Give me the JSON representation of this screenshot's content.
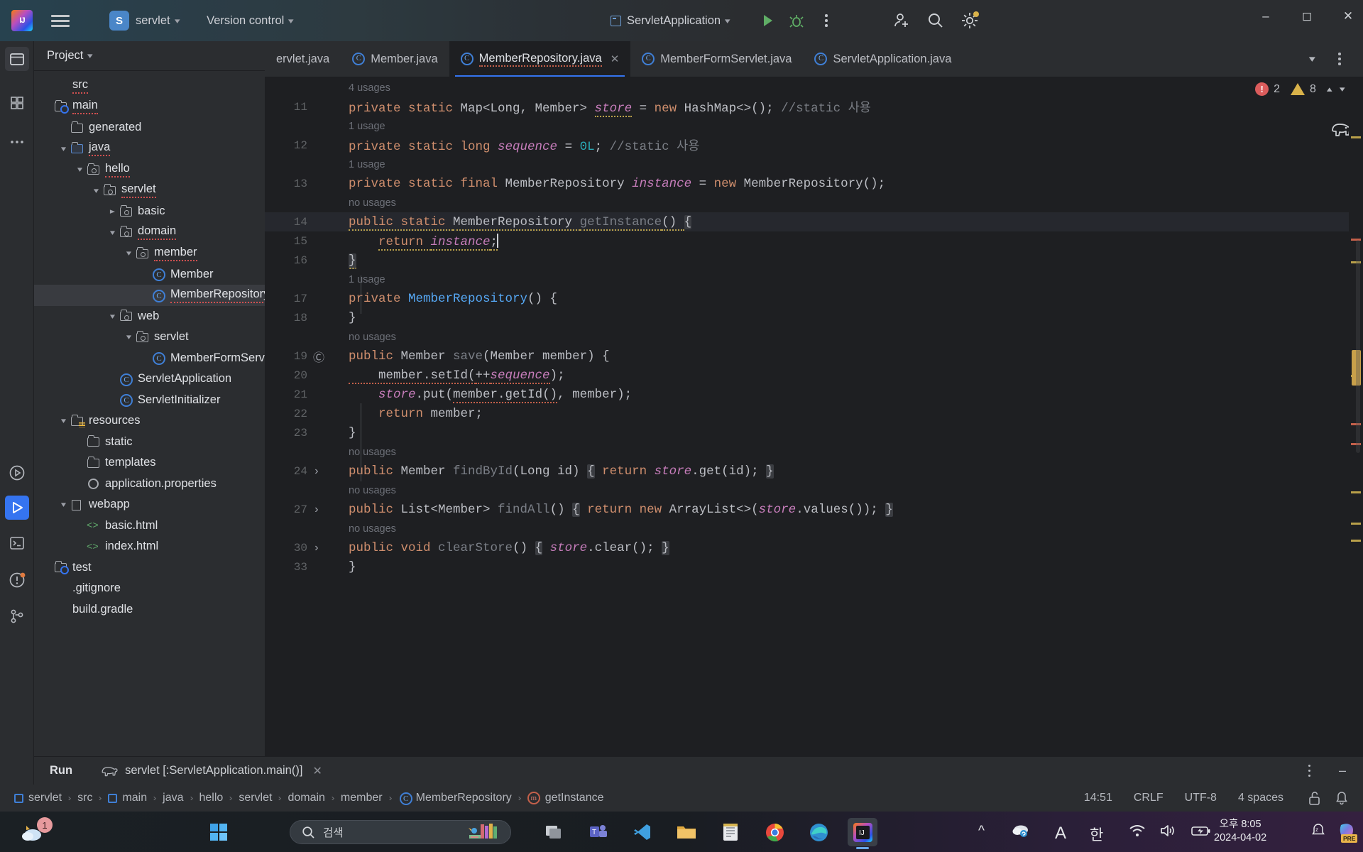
{
  "titlebar": {
    "logo": "intellij-logo",
    "project_initial": "S",
    "project_name": "servlet",
    "version_control": "Version control",
    "run_config": "ServletApplication",
    "icons": [
      "run-icon",
      "debug-icon",
      "more-actions-icon",
      "add-user-icon",
      "search-icon",
      "settings-icon"
    ],
    "window_controls": [
      "minimize",
      "maximize",
      "close"
    ]
  },
  "project_panel": {
    "title": "Project",
    "tree": [
      {
        "label": "src",
        "indent": 0,
        "arrow": "",
        "icon": "none",
        "squiggle": true
      },
      {
        "label": "main",
        "indent": 0,
        "arrow": "",
        "icon": "source-folder",
        "squiggle": true
      },
      {
        "label": "generated",
        "indent": 1,
        "arrow": "",
        "icon": "folder",
        "squiggle": false
      },
      {
        "label": "java",
        "indent": 1,
        "arrow": "down",
        "icon": "folder-blue",
        "squiggle": true
      },
      {
        "label": "hello",
        "indent": 2,
        "arrow": "down",
        "icon": "package",
        "squiggle": true
      },
      {
        "label": "servlet",
        "indent": 3,
        "arrow": "down",
        "icon": "package",
        "squiggle": true
      },
      {
        "label": "basic",
        "indent": 4,
        "arrow": "right",
        "icon": "package",
        "squiggle": false
      },
      {
        "label": "domain",
        "indent": 4,
        "arrow": "down",
        "icon": "package",
        "squiggle": true
      },
      {
        "label": "member",
        "indent": 5,
        "arrow": "down",
        "icon": "package",
        "squiggle": true
      },
      {
        "label": "Member",
        "indent": 6,
        "arrow": "",
        "icon": "class",
        "squiggle": false
      },
      {
        "label": "MemberRepository",
        "indent": 6,
        "arrow": "",
        "icon": "class",
        "squiggle": true,
        "selected": true
      },
      {
        "label": "web",
        "indent": 4,
        "arrow": "down",
        "icon": "package",
        "squiggle": false
      },
      {
        "label": "servlet",
        "indent": 5,
        "arrow": "down",
        "icon": "package",
        "squiggle": false
      },
      {
        "label": "MemberFormServlet",
        "indent": 6,
        "arrow": "",
        "icon": "class",
        "squiggle": false
      },
      {
        "label": "ServletApplication",
        "indent": 4,
        "arrow": "",
        "icon": "class",
        "squiggle": false
      },
      {
        "label": "ServletInitializer",
        "indent": 4,
        "arrow": "",
        "icon": "class",
        "squiggle": false
      },
      {
        "label": "resources",
        "indent": 1,
        "arrow": "down",
        "icon": "resource-folder",
        "squiggle": false
      },
      {
        "label": "static",
        "indent": 2,
        "arrow": "",
        "icon": "folder",
        "squiggle": false
      },
      {
        "label": "templates",
        "indent": 2,
        "arrow": "",
        "icon": "folder",
        "squiggle": false
      },
      {
        "label": "application.properties",
        "indent": 2,
        "arrow": "",
        "icon": "properties",
        "squiggle": false
      },
      {
        "label": "webapp",
        "indent": 1,
        "arrow": "down",
        "icon": "doc-folder",
        "squiggle": false
      },
      {
        "label": "basic.html",
        "indent": 2,
        "arrow": "",
        "icon": "html",
        "squiggle": false
      },
      {
        "label": "index.html",
        "indent": 2,
        "arrow": "",
        "icon": "html",
        "squiggle": false
      },
      {
        "label": "test",
        "indent": 0,
        "arrow": "",
        "icon": "source-folder",
        "squiggle": false
      },
      {
        "label": ".gitignore",
        "indent": 0,
        "arrow": "",
        "icon": "none",
        "squiggle": false
      },
      {
        "label": "build.gradle",
        "indent": 0,
        "arrow": "",
        "icon": "none",
        "squiggle": false
      }
    ]
  },
  "editor": {
    "tabs": [
      {
        "label": "ServletApplication.java",
        "icon": "class-icon",
        "active": false,
        "truncated_left": true,
        "display": "ervlet.java"
      },
      {
        "label": "Member.java",
        "icon": "class-icon",
        "active": false
      },
      {
        "label": "MemberRepository.java",
        "icon": "class-icon",
        "active": true,
        "closable": true
      },
      {
        "label": "MemberFormServlet.java",
        "icon": "class-icon",
        "active": false
      },
      {
        "label": "ServletApplication.java",
        "icon": "class-icon",
        "active": false
      }
    ],
    "tab_overflow_icons": [
      "chevron-down-icon",
      "more-tabs-icon"
    ],
    "inspections": {
      "errors": "2",
      "warnings": "8"
    },
    "lines": [
      {
        "type": "hint",
        "text": "4 usages"
      },
      {
        "type": "code",
        "num": "11",
        "tokens": [
          {
            "t": "private static ",
            "c": "kw"
          },
          {
            "t": "Map<Long, Member> ",
            "c": "pl"
          },
          {
            "t": "store",
            "c": "fld wv"
          },
          {
            "t": " = ",
            "c": "pl"
          },
          {
            "t": "new ",
            "c": "kw"
          },
          {
            "t": "HashMap<>(); ",
            "c": "pl"
          },
          {
            "t": "//static 사용",
            "c": "cmt"
          }
        ]
      },
      {
        "type": "hint",
        "text": "1 usage"
      },
      {
        "type": "code",
        "num": "12",
        "tokens": [
          {
            "t": "private static long ",
            "c": "kw"
          },
          {
            "t": "sequence",
            "c": "fld"
          },
          {
            "t": " = ",
            "c": "pl"
          },
          {
            "t": "0L",
            "c": "num"
          },
          {
            "t": "; ",
            "c": "pl"
          },
          {
            "t": "//static 사용",
            "c": "cmt"
          }
        ]
      },
      {
        "type": "hint",
        "text": "1 usage"
      },
      {
        "type": "code",
        "num": "13",
        "tokens": [
          {
            "t": "private static final ",
            "c": "kw"
          },
          {
            "t": "MemberRepository ",
            "c": "pl"
          },
          {
            "t": "instance",
            "c": "fld"
          },
          {
            "t": " = ",
            "c": "pl"
          },
          {
            "t": "new ",
            "c": "kw"
          },
          {
            "t": "MemberRepository();",
            "c": "pl"
          }
        ]
      },
      {
        "type": "hint",
        "text": "no usages"
      },
      {
        "type": "code",
        "num": "14",
        "current": true,
        "tokens": [
          {
            "t": "public static ",
            "c": "kw wv"
          },
          {
            "t": "MemberRepository ",
            "c": "pl wv"
          },
          {
            "t": "getInstance",
            "c": "mth wv"
          },
          {
            "t": "() ",
            "c": "pl wv"
          },
          {
            "t": "{",
            "c": "pl fold-chip"
          }
        ]
      },
      {
        "type": "code",
        "num": "15",
        "tokens": [
          {
            "t": "    ",
            "c": "pl"
          },
          {
            "t": "return ",
            "c": "kw wv"
          },
          {
            "t": "instance",
            "c": "fld wv"
          },
          {
            "t": ";",
            "c": "pl wv"
          }
        ]
      },
      {
        "type": "code",
        "num": "16",
        "tokens": [
          {
            "t": "}",
            "c": "pl wv fold-chip"
          }
        ]
      },
      {
        "type": "hint",
        "text": "1 usage"
      },
      {
        "type": "code",
        "num": "17",
        "tokens": [
          {
            "t": "private ",
            "c": "kw"
          },
          {
            "t": "MemberRepository",
            "c": "mthb"
          },
          {
            "t": "() {",
            "c": "pl"
          }
        ]
      },
      {
        "type": "code",
        "num": "18",
        "tokens": [
          {
            "t": "}",
            "c": "pl"
          }
        ]
      },
      {
        "type": "hint",
        "text": "no usages"
      },
      {
        "type": "code",
        "num": "19",
        "gutter": "@",
        "tokens": [
          {
            "t": "public ",
            "c": "kw"
          },
          {
            "t": "Member ",
            "c": "pl"
          },
          {
            "t": "save",
            "c": "mth"
          },
          {
            "t": "(Member member) {",
            "c": "pl"
          }
        ]
      },
      {
        "type": "code",
        "num": "20",
        "tokens": [
          {
            "t": "    member.setId(",
            "c": "pl wvr"
          },
          {
            "t": "++",
            "c": "pl wvr"
          },
          {
            "t": "sequence",
            "c": "fld wvr"
          },
          {
            "t": ");",
            "c": "pl"
          }
        ]
      },
      {
        "type": "code",
        "num": "21",
        "tokens": [
          {
            "t": "    ",
            "c": "pl"
          },
          {
            "t": "store",
            "c": "fld"
          },
          {
            "t": ".put(",
            "c": "pl"
          },
          {
            "t": "member.getId()",
            "c": "pl wvr"
          },
          {
            "t": ", member);",
            "c": "pl"
          }
        ]
      },
      {
        "type": "code",
        "num": "22",
        "tokens": [
          {
            "t": "    ",
            "c": "pl"
          },
          {
            "t": "return ",
            "c": "kw"
          },
          {
            "t": "member;",
            "c": "pl"
          }
        ]
      },
      {
        "type": "code",
        "num": "23",
        "tokens": [
          {
            "t": "}",
            "c": "pl"
          }
        ]
      },
      {
        "type": "hint",
        "text": "no usages"
      },
      {
        "type": "code",
        "num": "24",
        "gutter": ">",
        "tokens": [
          {
            "t": "public ",
            "c": "kw"
          },
          {
            "t": "Member ",
            "c": "pl"
          },
          {
            "t": "findById",
            "c": "mth"
          },
          {
            "t": "(Long id) ",
            "c": "pl"
          },
          {
            "t": "{",
            "c": "pl fold-chip"
          },
          {
            "t": " ",
            "c": "pl"
          },
          {
            "t": "return ",
            "c": "kw"
          },
          {
            "t": "store",
            "c": "fld"
          },
          {
            "t": ".get(id); ",
            "c": "pl"
          },
          {
            "t": "}",
            "c": "pl fold-chip"
          }
        ]
      },
      {
        "type": "hint",
        "text": "no usages"
      },
      {
        "type": "code",
        "num": "27",
        "gutter": ">",
        "tokens": [
          {
            "t": "public ",
            "c": "kw"
          },
          {
            "t": "List<Member> ",
            "c": "pl"
          },
          {
            "t": "findAll",
            "c": "mth"
          },
          {
            "t": "() ",
            "c": "pl"
          },
          {
            "t": "{",
            "c": "pl fold-chip"
          },
          {
            "t": " ",
            "c": "pl"
          },
          {
            "t": "return ",
            "c": "kw"
          },
          {
            "t": "new ",
            "c": "kw"
          },
          {
            "t": "ArrayList<>(",
            "c": "pl"
          },
          {
            "t": "store",
            "c": "fld"
          },
          {
            "t": ".values()); ",
            "c": "pl"
          },
          {
            "t": "}",
            "c": "pl fold-chip"
          }
        ]
      },
      {
        "type": "hint",
        "text": "no usages"
      },
      {
        "type": "code",
        "num": "30",
        "gutter": ">",
        "tokens": [
          {
            "t": "public void ",
            "c": "kw"
          },
          {
            "t": "clearStore",
            "c": "mth"
          },
          {
            "t": "() ",
            "c": "pl"
          },
          {
            "t": "{",
            "c": "pl fold-chip"
          },
          {
            "t": " ",
            "c": "pl"
          },
          {
            "t": "store",
            "c": "fld"
          },
          {
            "t": ".clear(); ",
            "c": "pl"
          },
          {
            "t": "}",
            "c": "pl fold-chip"
          }
        ]
      },
      {
        "type": "code",
        "num": "33",
        "tokens": [
          {
            "t": "}",
            "c": "pl"
          }
        ]
      }
    ]
  },
  "run_panel": {
    "title": "Run",
    "config_label": "servlet [:ServletApplication.main()]",
    "icons": [
      "gradle-elephant-icon",
      "close-icon",
      "more-icon",
      "minimize-icon"
    ]
  },
  "status_bar": {
    "breadcrumbs": [
      {
        "label": "servlet",
        "icon": "module"
      },
      {
        "label": "src",
        "icon": "none"
      },
      {
        "label": "main",
        "icon": "module"
      },
      {
        "label": "java",
        "icon": "none"
      },
      {
        "label": "hello",
        "icon": "none"
      },
      {
        "label": "servlet",
        "icon": "none"
      },
      {
        "label": "domain",
        "icon": "none"
      },
      {
        "label": "member",
        "icon": "none"
      },
      {
        "label": "MemberRepository",
        "icon": "class"
      },
      {
        "label": "getInstance",
        "icon": "method"
      }
    ],
    "caret_position": "14:51",
    "line_separator": "CRLF",
    "encoding": "UTF-8",
    "indent": "4 spaces",
    "lock_icon": "unlocked-icon"
  },
  "taskbar": {
    "weather_badge": "1",
    "search_placeholder": "검색",
    "apps": [
      "start-icon",
      "task-view-icon",
      "teams-icon",
      "vscode-icon",
      "explorer-icon",
      "notes-icon",
      "chrome-icon",
      "edge-icon",
      "intellij-icon"
    ],
    "tray": [
      "show-hidden-icon",
      "onedrive-icon",
      "ime-a-icon",
      "ime-korean-icon",
      "wifi-icon",
      "volume-icon",
      "battery-icon"
    ],
    "ime_latin": "A",
    "ime_korean": "한",
    "clock_time": "오후 8:05",
    "clock_date": "2024-04-02",
    "focus_icon": "do-not-disturb-icon",
    "copilot_badge": "PRE"
  },
  "colors": {
    "accent": "#3574f0",
    "bg_dark": "#1e1f22",
    "bg_panel": "#2b2d30",
    "selection": "#393b40",
    "error": "#db5c5c",
    "warning": "#d9b24a",
    "keyword": "#cf8e6d",
    "field": "#c77dbb",
    "number": "#2aacb8"
  }
}
